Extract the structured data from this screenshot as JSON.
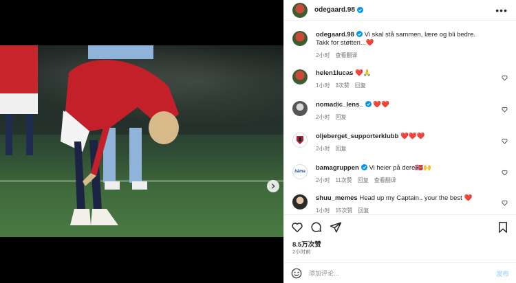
{
  "post": {
    "author": "odegaard.98",
    "caption_line1": "Vi skal stå sammen, lære og bli bedre.",
    "caption_line2": "Takk for støtten...❤️",
    "caption_time": "2小时",
    "caption_translate": "查看翻译"
  },
  "media": {
    "carousel_count": 2,
    "active_index": 0
  },
  "comments": [
    {
      "user": "helen1lucas",
      "text": "❤️🙏",
      "time": "1小时",
      "likes": "3次赞",
      "reply": "回复",
      "verified": false,
      "translate": ""
    },
    {
      "user": "nomadic_lens_",
      "text": "❤️❤️",
      "time": "2小时",
      "likes": "",
      "reply": "回复",
      "verified": true,
      "translate": ""
    },
    {
      "user": "oljeberget_supporterklubb",
      "text": "❤️❤️❤️",
      "time": "2小时",
      "likes": "",
      "reply": "回复",
      "verified": false,
      "translate": ""
    },
    {
      "user": "bamagruppen",
      "text": "Vi heier på dere🇳🇴🙌",
      "time": "2小时",
      "likes": "11次赞",
      "reply": "回复",
      "verified": true,
      "translate": "查看翻译"
    },
    {
      "user": "shuu_memes",
      "text": "Head up my Captain.. your the best ❤️",
      "time": "1小时",
      "likes": "15次赞",
      "reply": "回复",
      "verified": false,
      "translate": ""
    }
  ],
  "stats": {
    "like_count": "8.5万次赞",
    "posted_time": "2小时前"
  },
  "composer": {
    "placeholder": "添加评论...",
    "post_label": "发布"
  },
  "colors": {
    "verified": "#0095f6",
    "heart": "#ed4956",
    "post_button_disabled": "#b3dbff"
  },
  "icons": [
    "more-options-icon",
    "verified-badge-icon",
    "heart-icon",
    "comment-icon",
    "share-icon",
    "bookmark-icon",
    "emoji-icon",
    "chevron-right-icon"
  ]
}
